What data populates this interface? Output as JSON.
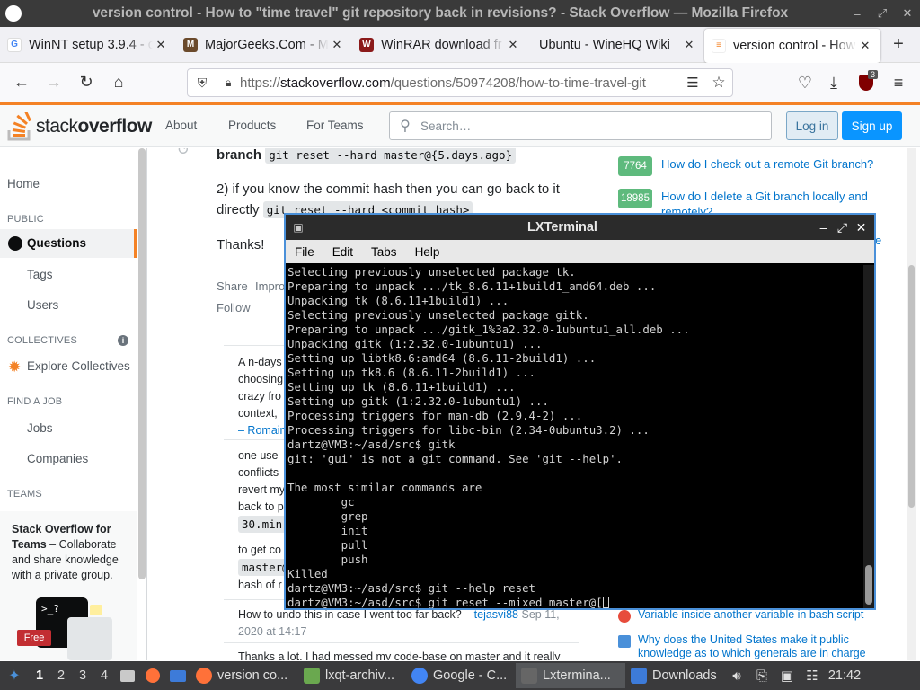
{
  "window": {
    "title": "version control - How to \"time travel\" git repository back in revisions? - Stack Overflow — Mozilla Firefox"
  },
  "tabs": [
    {
      "label": "WinNT setup 3.9.4 - c",
      "icon": "google-icon",
      "color": "#4285f4"
    },
    {
      "label": "MajorGeeks.Com - M",
      "icon": "majorgeeks-icon",
      "color": "#6b4a2b"
    },
    {
      "label": "WinRAR download fr",
      "icon": "winrar-icon",
      "color": "#8b1a1a"
    },
    {
      "label": "Ubuntu - WineHQ Wiki",
      "icon": "",
      "color": ""
    },
    {
      "label": "version control - How",
      "icon": "stackoverflow-icon",
      "color": "#f48225",
      "active": true
    }
  ],
  "nav": {
    "url_prefix": "https://",
    "url_host": "stackoverflow.com",
    "url_rest": "/questions/50974208/how-to-time-travel-git",
    "ublock_badge": "3"
  },
  "so": {
    "logo_light": "stack",
    "logo_bold": "overflow",
    "nav_about": "About",
    "nav_products": "Products",
    "nav_teams": "For Teams",
    "search_placeholder": "Search…",
    "login": "Log in",
    "signup": "Sign up"
  },
  "leftnav": {
    "home": "Home",
    "public": "PUBLIC",
    "questions": "Questions",
    "tags": "Tags",
    "users": "Users",
    "collectives": "COLLECTIVES",
    "explore": "Explore Collectives",
    "findjob": "FIND A JOB",
    "jobs": "Jobs",
    "companies": "Companies",
    "teams": "TEAMS",
    "teams_title": "Stack Overflow for Teams",
    "teams_body": " – Collaborate and share knowledge with a private group.",
    "free": "Free"
  },
  "main": {
    "branch_word": "branch",
    "branch_code": "git reset --hard master@{5.days.ago}",
    "step2_text": "2) if you know the commit hash then you can go back to it directly",
    "step2_code": "git reset --hard <commit_hash>",
    "thanks": "Thanks!",
    "share": "Share",
    "improve": "Impro",
    "follow": "Follow",
    "c1_lines": [
      "A n-days",
      "choosing",
      "crazy fro",
      "context,"
    ],
    "c1_author": "– Romain",
    "c2_lines": [
      "one use",
      "conflicts",
      "revert my",
      "back to p"
    ],
    "c2_code": "30.min",
    "c3_lines": [
      "to get co"
    ],
    "c3_code": "master@",
    "c3_tail": "hash of r",
    "c4_text": "How to undo this in case I went too far back? – ",
    "c4_author": "tejasvi88",
    "c4_date": "Sep 11, 2020 at 14:17",
    "c5_text": "Thanks a lot, I had messed my code-base on master and it really"
  },
  "right": {
    "q1_score": "7764",
    "q1_title": "How do I check out a remote Git branch?",
    "q2_score": "18985",
    "q2_title": "How do I delete a Git branch locally and remotely?",
    "q3_fragment": "e",
    "hot1": "Variable inside another variable in bash script",
    "hot2": "Why does the United States make it public knowledge as to which generals are in charge of"
  },
  "terminal": {
    "title": "LXTerminal",
    "menu": [
      "File",
      "Edit",
      "Tabs",
      "Help"
    ],
    "lines": [
      "Selecting previously unselected package tk.",
      "Preparing to unpack .../tk_8.6.11+1build1_amd64.deb ...",
      "Unpacking tk (8.6.11+1build1) ...",
      "Selecting previously unselected package gitk.",
      "Preparing to unpack .../gitk_1%3a2.32.0-1ubuntu1_all.deb ...",
      "Unpacking gitk (1:2.32.0-1ubuntu1) ...",
      "Setting up libtk8.6:amd64 (8.6.11-2build1) ...",
      "Setting up tk8.6 (8.6.11-2build1) ...",
      "Setting up tk (8.6.11+1build1) ...",
      "Setting up gitk (1:2.32.0-1ubuntu1) ...",
      "Processing triggers for man-db (2.9.4-2) ...",
      "Processing triggers for libc-bin (2.34-0ubuntu3.2) ...",
      "dartz@VM3:~/asd/src$ gitk",
      "git: 'gui' is not a git command. See 'git --help'.",
      "",
      "The most similar commands are",
      "        gc",
      "        grep",
      "        init",
      "        pull",
      "        push",
      "Killed",
      "dartz@VM3:~/asd/src$ git --help reset"
    ],
    "prompt_line": "dartz@VM3:~/asd/src$ git reset --mixed master@["
  },
  "taskbar": {
    "workspaces": [
      "1",
      "2",
      "3",
      "4"
    ],
    "tasks": [
      {
        "label": "version co...",
        "icon": "firefox-icon",
        "color": "#ff7139"
      },
      {
        "label": "lxqt-archiv...",
        "icon": "archive-icon",
        "color": "#6aa84f"
      },
      {
        "label": "Google - C...",
        "icon": "chrome-icon",
        "color": "#4285f4"
      },
      {
        "label": "Lxtermina...",
        "icon": "terminal-icon",
        "color": "#666666",
        "active": true
      },
      {
        "label": "Downloads",
        "icon": "folder-icon",
        "color": "#3d7bd9"
      }
    ],
    "clock": "21:42"
  }
}
